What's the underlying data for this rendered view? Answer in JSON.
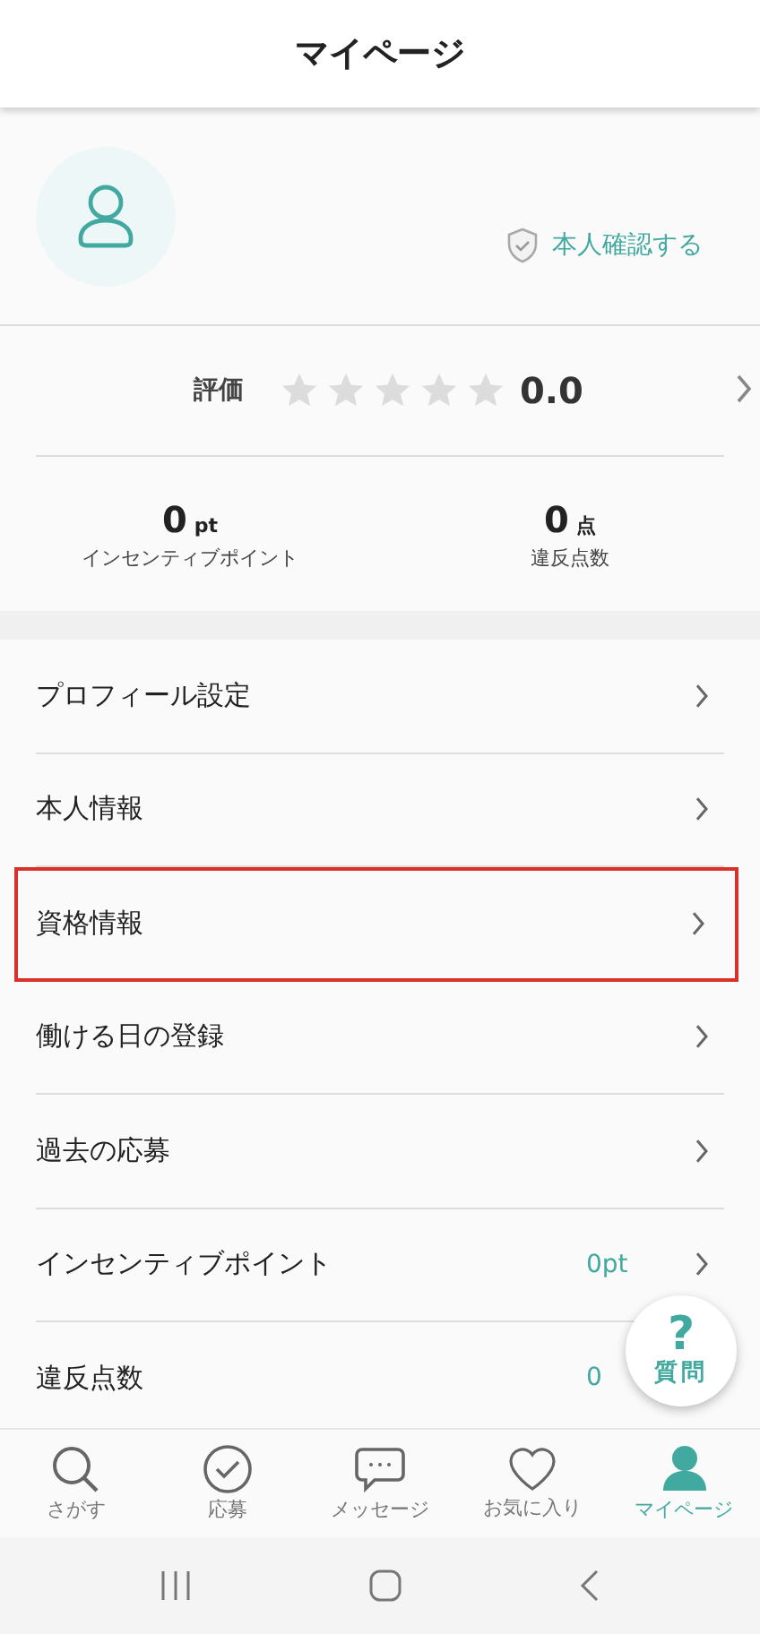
{
  "header": {
    "title": "マイページ"
  },
  "profile": {
    "verify_label": "本人確認する",
    "rating_label": "評価",
    "stars": 0,
    "rating_value": "0.0",
    "stats": [
      {
        "value": "0",
        "unit": "pt",
        "label": "インセンティブポイント"
      },
      {
        "value": "0",
        "unit": "点",
        "label": "違反点数"
      }
    ]
  },
  "menu": [
    {
      "label": "プロフィール設定",
      "highlighted": false,
      "chevron": true
    },
    {
      "label": "本人情報",
      "highlighted": false,
      "chevron": true
    },
    {
      "label": "資格情報",
      "highlighted": true,
      "chevron": true
    },
    {
      "label": "働ける日の登録",
      "highlighted": false,
      "chevron": true
    },
    {
      "label": "過去の応募",
      "highlighted": false,
      "chevron": true
    },
    {
      "label": "インセンティブポイント",
      "value": "0pt",
      "highlighted": false,
      "chevron": true
    },
    {
      "label": "違反点数",
      "value": "0",
      "highlighted": false,
      "chevron": false
    }
  ],
  "help_button": {
    "icon": "?",
    "label": "質問"
  },
  "bottom_nav": [
    {
      "kind": "search",
      "label": "さがす",
      "selected": false
    },
    {
      "kind": "check",
      "label": "応募",
      "selected": false
    },
    {
      "kind": "chat",
      "label": "メッセージ",
      "selected": false
    },
    {
      "kind": "heart",
      "label": "お気に入り",
      "selected": false
    },
    {
      "kind": "person",
      "label": "マイページ",
      "selected": true
    }
  ]
}
